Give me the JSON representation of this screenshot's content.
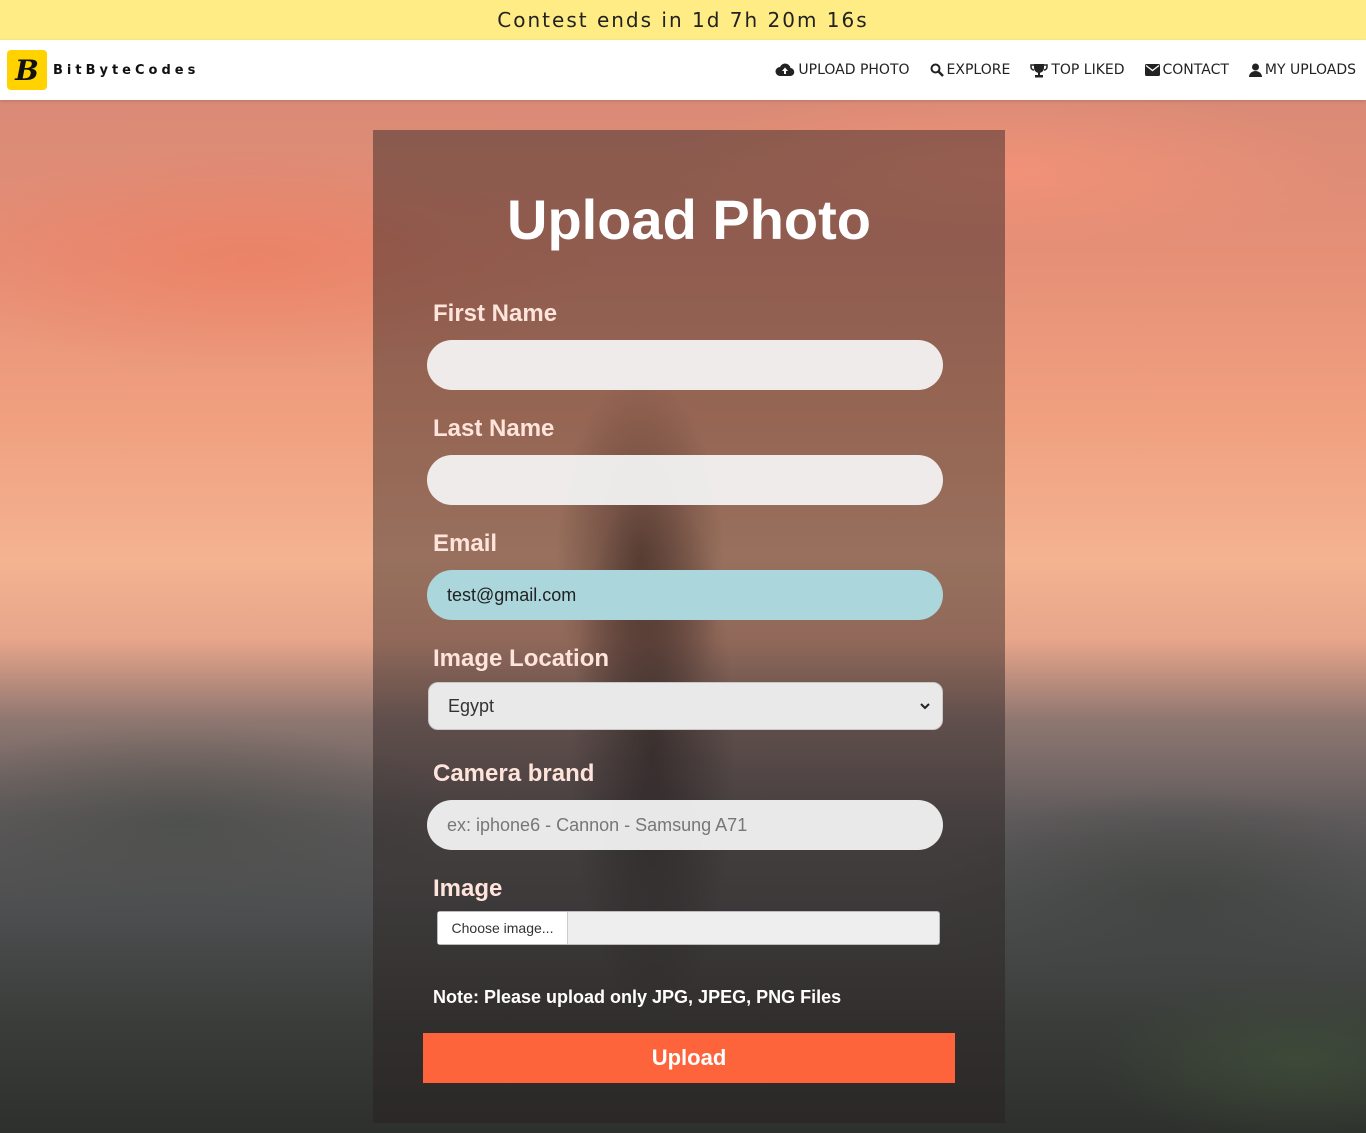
{
  "banner": {
    "text": "Contest ends in 1d 7h 20m 16s"
  },
  "brand": {
    "logo_letter": "B",
    "name": "BitByteCodes"
  },
  "nav": {
    "items": [
      {
        "label": "UPLOAD PHOTO",
        "icon": "cloud-upload-icon"
      },
      {
        "label": "EXPLORE",
        "icon": "search-icon"
      },
      {
        "label": "TOP LIKED",
        "icon": "trophy-icon"
      },
      {
        "label": "CONTACT",
        "icon": "envelope-icon"
      },
      {
        "label": "MY UPLOADS",
        "icon": "user-icon"
      }
    ]
  },
  "form": {
    "title": "Upload Photo",
    "first_name": {
      "label": "First Name",
      "value": ""
    },
    "last_name": {
      "label": "Last Name",
      "value": ""
    },
    "email": {
      "label": "Email",
      "value": "test@gmail.com"
    },
    "location": {
      "label": "Image Location",
      "selected": "Egypt"
    },
    "camera": {
      "label": "Camera brand",
      "placeholder": "ex: iphone6 - Cannon - Samsung A71",
      "value": ""
    },
    "image": {
      "label": "Image",
      "button": "Choose image..."
    },
    "note": "Note: Please upload only JPG, JPEG, PNG Files",
    "submit": "Upload"
  },
  "colors": {
    "banner_bg": "#ffec84",
    "logo_bg": "#ffd200",
    "accent": "#fe643c",
    "email_field_bg": "#abd6dc"
  }
}
